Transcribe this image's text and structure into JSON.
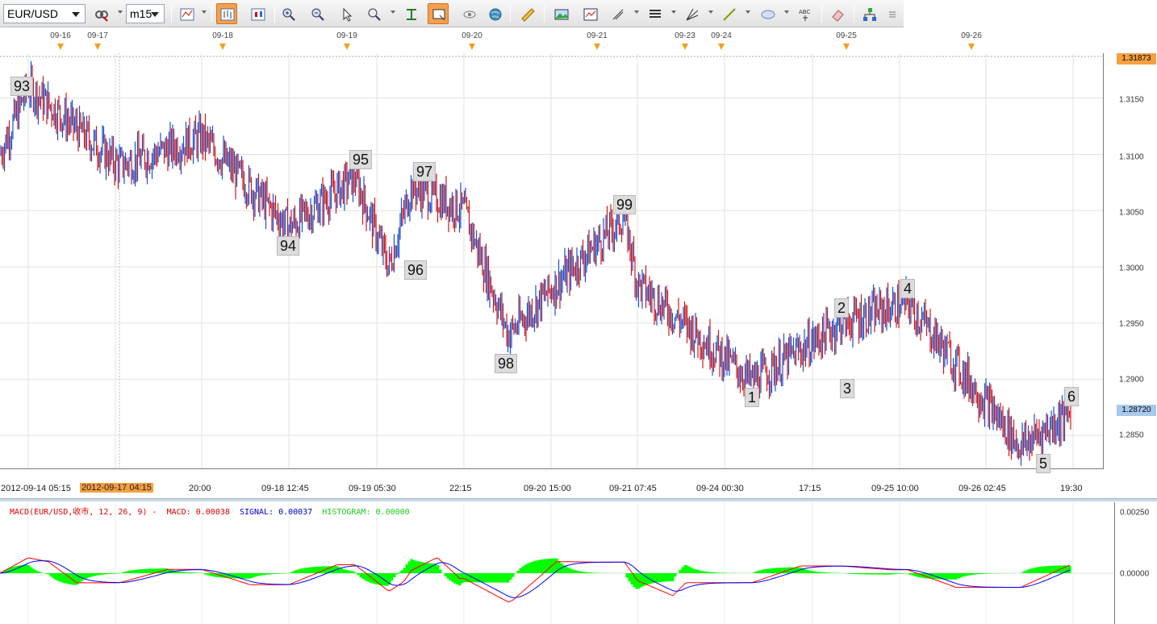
{
  "toolbar": {
    "symbol": "EUR/USD",
    "timeframe": "m15",
    "active_tools": [
      "bar-chart-icon",
      "rectangle-icon"
    ]
  },
  "date_markers": [
    "09-16",
    "09-17",
    "09-18",
    "09-19",
    "09-20",
    "09-21",
    "09-23",
    "09-24",
    "09-25",
    "09-26"
  ],
  "price_axis": {
    "top_badge": "1.31873",
    "current_badge": "1.28720",
    "labels": [
      "1.3150",
      "1.3100",
      "1.3050",
      "1.3000",
      "1.2950",
      "1.2900",
      "1.2850"
    ]
  },
  "time_axis": {
    "labels": [
      "2012-09-14 05:15",
      "2012-09-17 04:15",
      "20:00",
      "09-18 12:45",
      "09-19 05:30",
      "22:15",
      "09-20 15:00",
      "09-21 07:45",
      "09-24 00:30",
      "17:15",
      "09-25 10:00",
      "09-26 02:45",
      "19:30"
    ],
    "highlight": "2012-09-17 04:15"
  },
  "wave_labels": [
    "93",
    "94",
    "95",
    "96",
    "97",
    "98",
    "99",
    "1",
    "2",
    "3",
    "4",
    "5",
    "6"
  ],
  "macd": {
    "legend": "MACD(EUR/USD,收市, 12, 26, 9) -",
    "macd_value": "MACD: 0.00038",
    "signal_value": "SIGNAL: 0.00037",
    "histogram_value": "HISTOGRAM: 0.00000",
    "axis_labels": [
      "0.00250",
      "0.00000"
    ]
  },
  "colors": {
    "up_candle": "#1a4fd0",
    "down_candle": "#d01818",
    "macd_line": "#ff0000",
    "signal_line": "#0000ff",
    "histogram": "#00ff00",
    "highlight": "#f5a041"
  },
  "chart_data": {
    "type": "line",
    "title": "",
    "xlabel": "",
    "ylabel": "",
    "ylim": [
      1.282,
      1.319
    ],
    "x": [
      "2012-09-14 05:15",
      "2012-09-14 12:00",
      "2012-09-17 04:15",
      "2012-09-17 20:00",
      "2012-09-18 12:45",
      "2012-09-19 00:00",
      "2012-09-19 05:30",
      "2012-09-19 09:00",
      "2012-09-19 22:15",
      "2012-09-20 08:00",
      "2012-09-20 15:00",
      "2012-09-21 07:45",
      "2012-09-21 14:00",
      "2012-09-24 00:30",
      "2012-09-24 17:15",
      "2012-09-25 10:00",
      "2012-09-26 02:45",
      "2012-09-26 19:30"
    ],
    "series": [
      {
        "values": [
          1.31,
          1.316,
          1.309,
          1.3115,
          1.3035,
          1.308,
          1.3,
          1.3072,
          1.305,
          1.294,
          1.298,
          1.3045,
          1.2985,
          1.2898,
          1.295,
          1.2968,
          1.284,
          1.2872
        ]
      }
    ]
  }
}
